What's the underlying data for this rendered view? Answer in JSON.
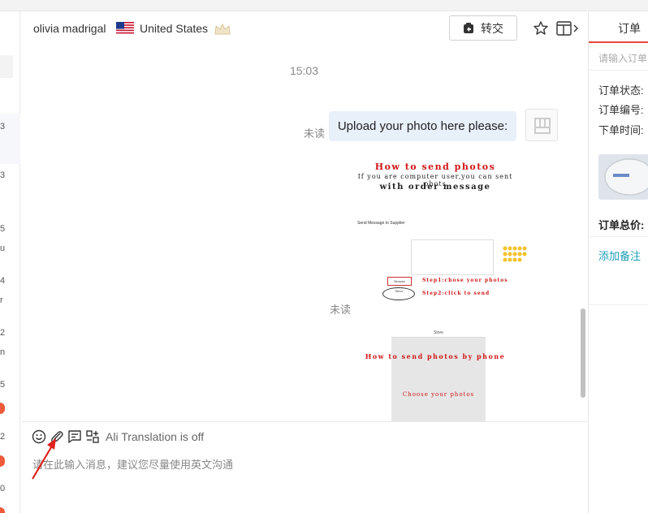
{
  "chat": {
    "user_name": "olivia madrigal",
    "country": "United States",
    "transfer_label": "转交",
    "timestamp": "15:03",
    "unread_label": "未读",
    "message_text": "Upload your photo here please:",
    "translation_status": "Ali Translation is off",
    "input_placeholder": "请在此输入消息，建议您尽量使用英文沟通"
  },
  "photo_message": {
    "title": "How to send photos",
    "line1": "If you are computer user,you can sent phots",
    "line2": "with order message",
    "form_title": "Send Message to Supplier",
    "browse_label": "Browse",
    "send_label": "Send",
    "step1": "Step1:chose your photos",
    "step2": "Step2:click to send",
    "store_label": "Store",
    "phone_title": "How to send photos by phone",
    "choose_label": "Choose your photos"
  },
  "left_list": {
    "fragments": [
      "3",
      "3",
      "5",
      "u",
      "4",
      "r",
      "2",
      "n",
      "5",
      "2",
      "0"
    ]
  },
  "right_panel": {
    "tab_label": "订单",
    "search_placeholder": "请输入订单号",
    "status_label": "订单状态:",
    "number_label": "订单编号:",
    "time_label": "下单时间:",
    "total_label": "订单总价:",
    "add_note_label": "添加备注"
  },
  "colors": {
    "accent_red": "#e8473b",
    "bubble_bg": "#e8f0fa",
    "link_teal": "#1a9db5"
  }
}
